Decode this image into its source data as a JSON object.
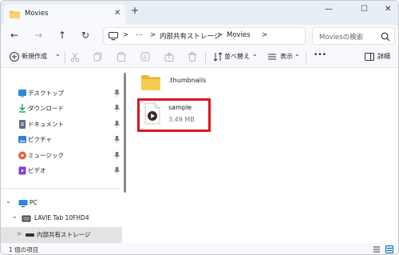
{
  "tab": {
    "title": "Movies",
    "close": "✕",
    "add": "+"
  },
  "window_controls": {
    "minimize": "—",
    "maximize": "☐",
    "close": "✕"
  },
  "nav": {
    "back": "←",
    "forward": "→",
    "up": "↑",
    "refresh": "↻"
  },
  "address": {
    "more": "⋯",
    "sep1": ">",
    "segment1": "内部共有ストレージ",
    "sep2": ">",
    "segment2": "Movies",
    "sep3": ">"
  },
  "search": {
    "placeholder": "Moviesの検索"
  },
  "toolbar": {
    "new_label": "新規作成",
    "new_arrow": "⌄",
    "sort_label": "並べ替え",
    "sort_arrow": "⌄",
    "view_label": "表示",
    "view_arrow": "⌄",
    "more": "•••",
    "details_label": "詳細"
  },
  "sidebar": {
    "quick_access": [
      {
        "label": "デスクトップ",
        "icon": "desktop-icon",
        "color": "#2b88d8"
      },
      {
        "label": "ダウンロード",
        "icon": "download-icon",
        "color": "#1aa45c"
      },
      {
        "label": "ドキュメント",
        "icon": "document-icon",
        "color": "#5a6e85"
      },
      {
        "label": "ピクチャ",
        "icon": "pictures-icon",
        "color": "#2f7fd8"
      },
      {
        "label": "ミュージック",
        "icon": "music-icon",
        "color": "#e8603c"
      },
      {
        "label": "ビデオ",
        "icon": "video-icon",
        "color": "#8a3fd1"
      }
    ],
    "pc": {
      "label": "PC",
      "chevron": "⌄"
    },
    "device": {
      "label": "LAVIE Tab 10FHD4",
      "chevron": "⌄"
    },
    "storage": {
      "label": "内部共有ストレージ",
      "chevron": ">"
    }
  },
  "files": [
    {
      "name": ".thumbnails",
      "type": "folder",
      "size": ""
    },
    {
      "name": "sample",
      "type": "video",
      "size": "3.49 MB"
    }
  ],
  "status": {
    "count_text": "1 個の項目"
  },
  "colors": {
    "highlight": "#e0141b",
    "folder": "#f4c542",
    "accent": "#0067c0"
  }
}
